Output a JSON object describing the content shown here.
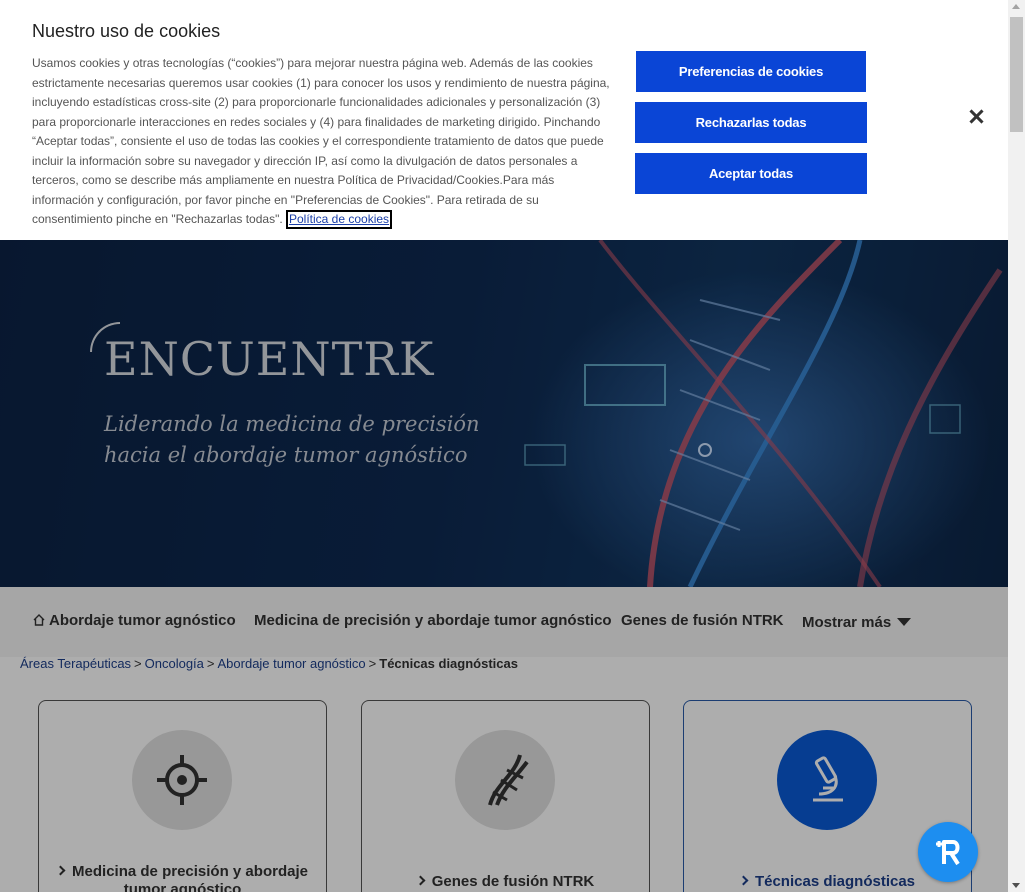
{
  "cookie_banner": {
    "title": "Nuestro uso de cookies",
    "body": "Usamos cookies y otras tecnologías (“cookies”) para mejorar nuestra página web. Además de las cookies estrictamente necesarias queremos usar cookies (1) para conocer los usos y rendimiento de nuestra página, incluyendo estadísticas cross-site (2) para proporcionarle funcionalidades adicionales y personalización (3) para proporcionarle interacciones en redes sociales y (4) para finalidades de marketing dirigido. Pinchando “Aceptar todas”, consiente el uso de todas las cookies y el correspondiente tratamiento de datos que puede incluir la información sobre su navegador y dirección IP, así como la divulgación de datos personales a terceros, como se describe más ampliamente en nuestra Política de Privacidad/Cookies.Para más información y configuración, por favor pinche en \"Preferencias de Cookies\". Para retirada de su consentimiento pinche en \"Rechazarlas todas\". ",
    "policy_link": "Política de cookies",
    "preferences_button": "Preferencias de cookies",
    "reject_button": "Rechazarlas todas",
    "accept_button": "Aceptar todas",
    "colors": {
      "button": "#0a45d6"
    }
  },
  "hero": {
    "logo": "ENCUENTRK",
    "tagline_line1": "Liderando la medicina de precisión",
    "tagline_line2": "hacia el abordaje tumor agnóstico"
  },
  "nav": {
    "items": [
      "Abordaje tumor agnóstico",
      "Medicina de precisión y abordaje tumor agnóstico",
      "Genes de fusión NTRK"
    ],
    "more": "Mostrar más"
  },
  "breadcrumb": {
    "items": [
      "Áreas Terapéuticas",
      "Oncología",
      "Abordaje tumor agnóstico"
    ],
    "separator": ">",
    "current": "Técnicas diagnósticas"
  },
  "cards": [
    {
      "label": "Medicina de precisión y abordaje tumor agnóstico",
      "icon": "crosshair-icon"
    },
    {
      "label": "Genes de fusión NTRK",
      "icon": "dna-icon"
    },
    {
      "label": "Técnicas diagnósticas",
      "icon": "microscope-icon",
      "active": true
    }
  ]
}
